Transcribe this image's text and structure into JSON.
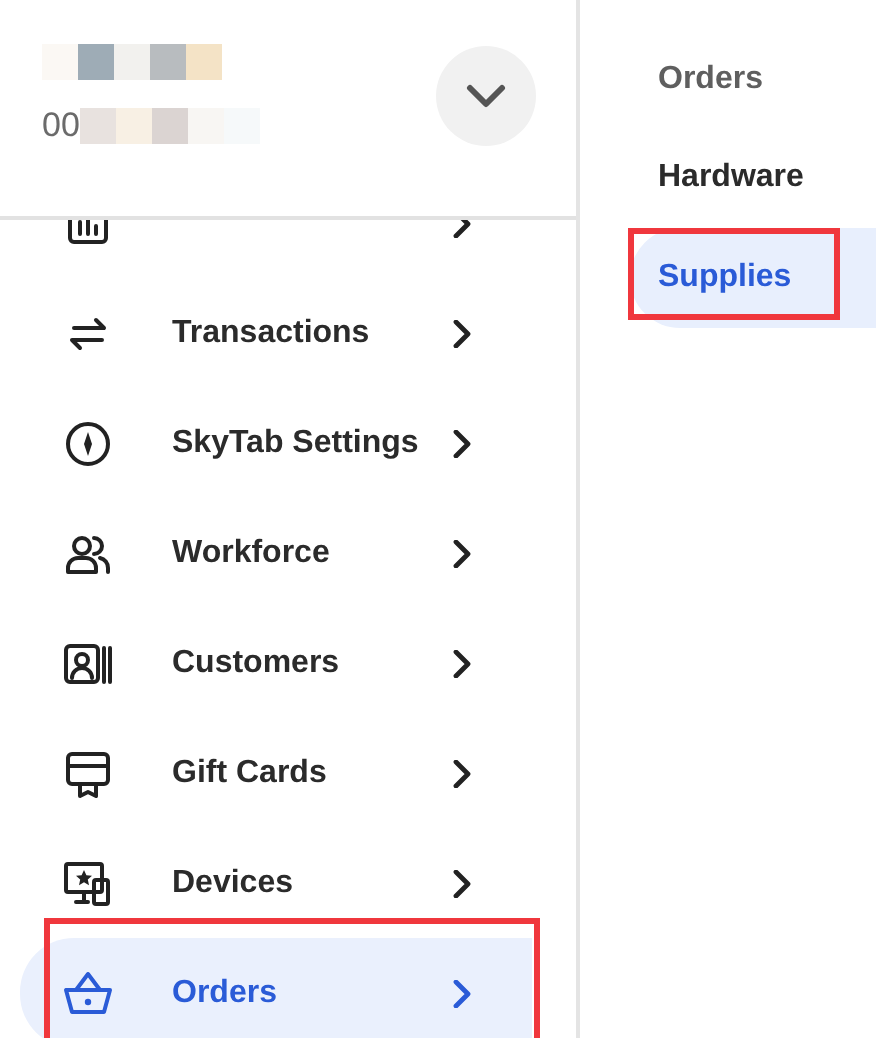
{
  "account": {
    "id_prefix": "00"
  },
  "nav": {
    "items": [
      {
        "selected": false,
        "annotated": false
      },
      {
        "label": "Transactions",
        "selected": false,
        "annotated": false
      },
      {
        "label": "SkyTab Settings",
        "selected": false,
        "annotated": false
      },
      {
        "label": "Workforce",
        "selected": false,
        "annotated": false
      },
      {
        "label": "Customers",
        "selected": false,
        "annotated": false
      },
      {
        "label": "Gift Cards",
        "selected": false,
        "annotated": false
      },
      {
        "label": "Devices",
        "selected": false,
        "annotated": false
      },
      {
        "label": "Orders",
        "selected": true,
        "annotated": true
      }
    ]
  },
  "submenu": {
    "title": "Orders",
    "items": [
      {
        "label": "Hardware",
        "selected": false,
        "annotated": false
      },
      {
        "label": "Supplies",
        "selected": true,
        "annotated": true
      }
    ]
  }
}
